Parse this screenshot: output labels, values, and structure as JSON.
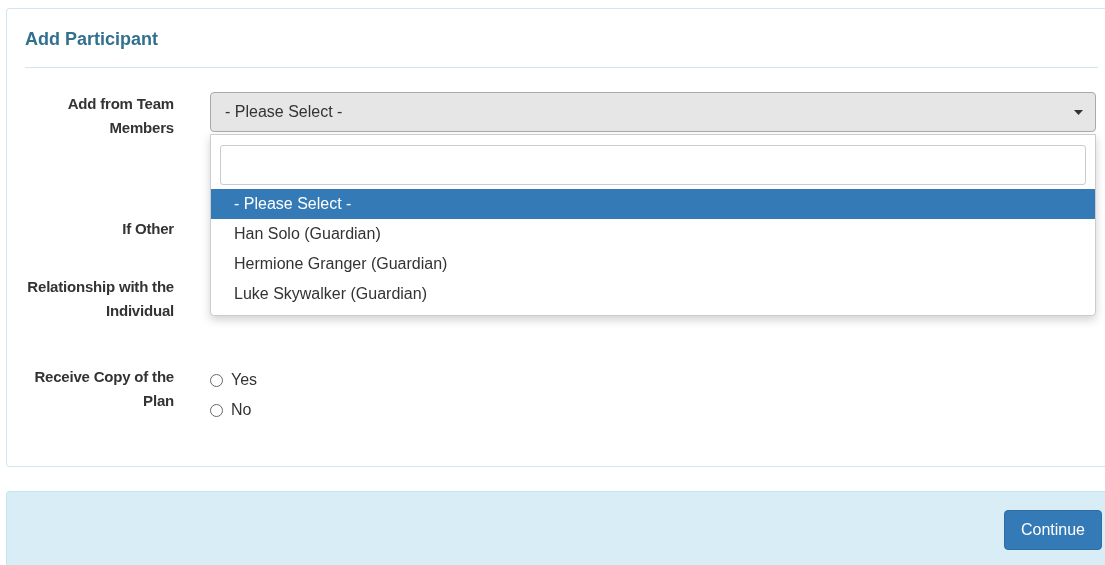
{
  "panel": {
    "title": "Add Participant"
  },
  "team_members": {
    "label": "Add from Team Members",
    "value": "- Please Select -",
    "expanded": true,
    "options": [
      {
        "label": "- Please Select -",
        "selected": true
      },
      {
        "label": "Han Solo (Guardian)",
        "selected": false
      },
      {
        "label": "Hermione Granger (Guardian)",
        "selected": false
      },
      {
        "label": "Luke Skywalker (Guardian)",
        "selected": false
      }
    ]
  },
  "if_other": {
    "label": "If Other"
  },
  "relationship": {
    "label": "Relationship with the Individual"
  },
  "receive_copy": {
    "label": "Receive Copy of the Plan",
    "options": [
      {
        "label": "Yes",
        "selected": false
      },
      {
        "label": "No",
        "selected": false
      }
    ]
  },
  "footer": {
    "button": "Continue"
  }
}
